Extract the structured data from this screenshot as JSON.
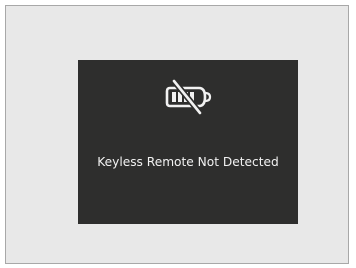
{
  "display": {
    "message": "Keyless Remote Not Detected",
    "icon": "keyless-remote-not-detected-icon"
  },
  "colors": {
    "page_background": "#ffffff",
    "frame_background": "#e8e8e8",
    "frame_border": "#a8a8a8",
    "screen_background": "#2e2e2d",
    "foreground": "#f2f2f2"
  }
}
